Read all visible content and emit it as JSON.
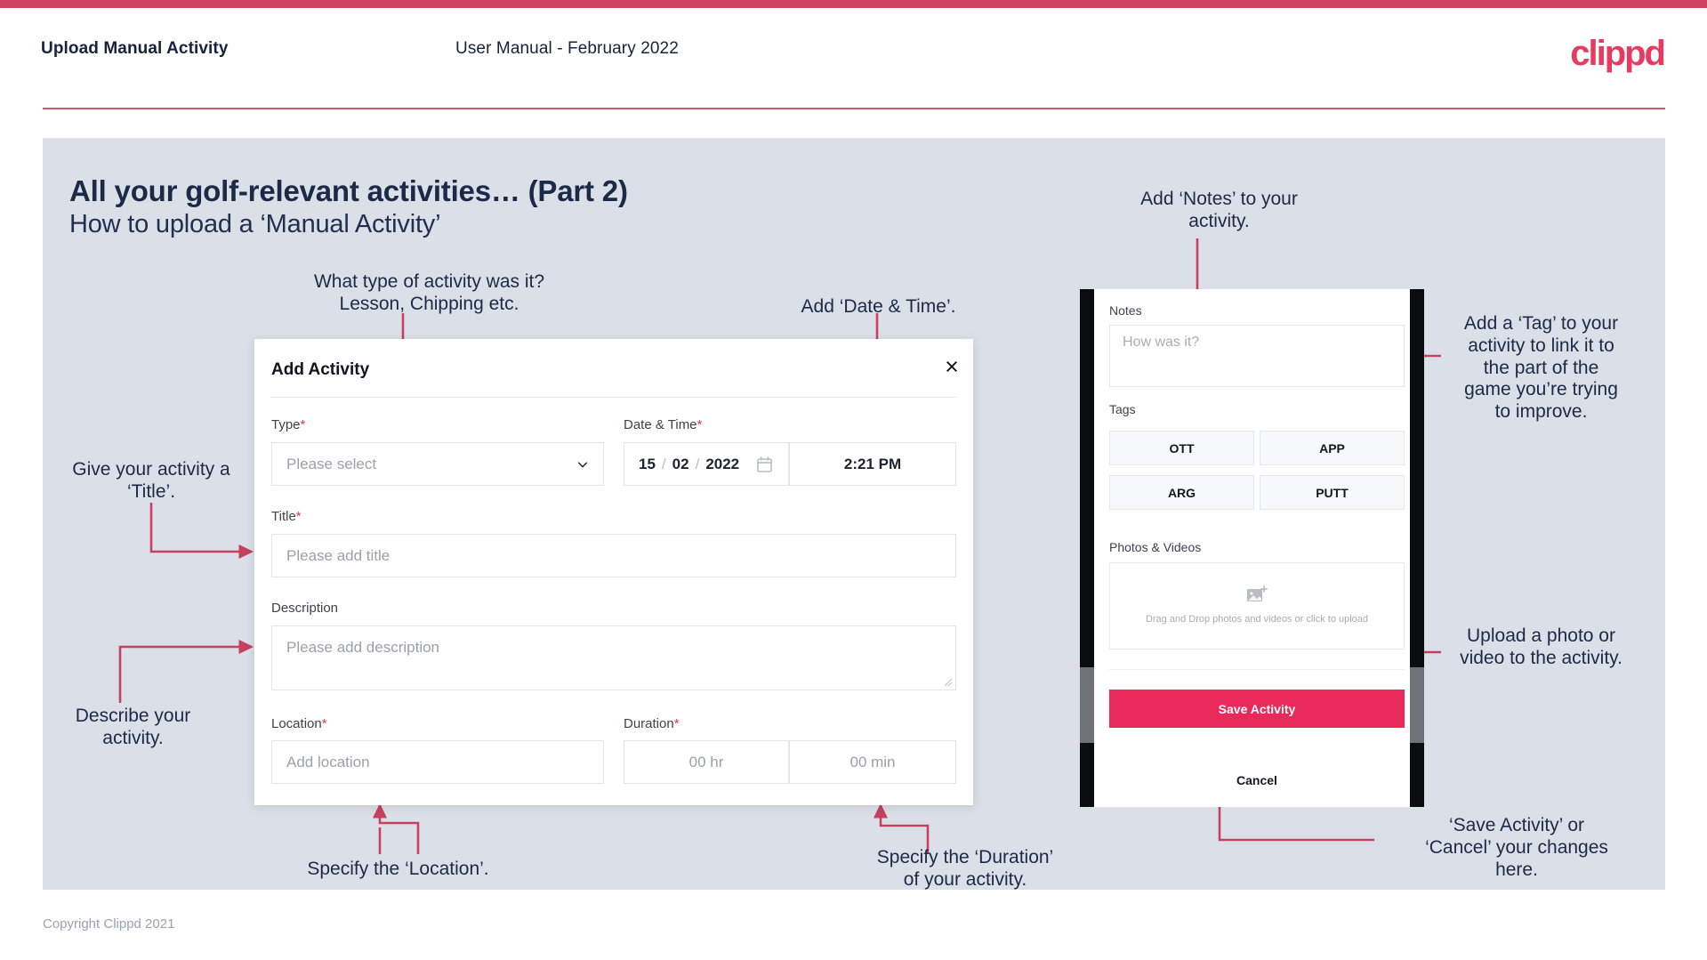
{
  "header": {
    "title": "Upload Manual Activity",
    "subtitle": "User Manual - February 2022",
    "logo": "clippd"
  },
  "slide": {
    "heading": "All your golf-relevant activities… (Part 2)",
    "subheading": "How to upload a ‘Manual Activity’",
    "copyright": "Copyright Clippd 2021"
  },
  "dialog": {
    "title": "Add Activity",
    "close_icon": "×",
    "fields": {
      "type": {
        "label": "Type",
        "required": "*",
        "placeholder": "Please select"
      },
      "datetime": {
        "label": "Date & Time",
        "required": "*",
        "day": "15",
        "month": "02",
        "year": "2022",
        "sep": "/",
        "time": "2:21 PM"
      },
      "title": {
        "label": "Title",
        "required": "*",
        "placeholder": "Please add title"
      },
      "description": {
        "label": "Description",
        "required": "",
        "placeholder": "Please add description"
      },
      "location": {
        "label": "Location",
        "required": "*",
        "placeholder": "Add location"
      },
      "duration": {
        "label": "Duration",
        "required": "*",
        "hours": "00 hr",
        "minutes": "00 min"
      }
    }
  },
  "phone": {
    "notes_label": "Notes",
    "notes_placeholder": "How was it?",
    "tags_label": "Tags",
    "tags": [
      "OTT",
      "APP",
      "ARG",
      "PUTT"
    ],
    "photos_label": "Photos & Videos",
    "drop_text": "Drag and Drop photos and videos or\nclick to upload",
    "save_label": "Save Activity",
    "cancel_label": "Cancel"
  },
  "annotations": {
    "type": "What type of activity was it?\nLesson, Chipping etc.",
    "datetime": "Add ‘Date & Time’.",
    "title": "Give your activity a\n‘Title’.",
    "description": "Describe your\nactivity.",
    "location": "Specify the ‘Location’.",
    "duration": "Specify the ‘Duration’\nof your activity.",
    "notes": "Add ‘Notes’ to your\nactivity.",
    "tags": "Add a ‘Tag’ to your\nactivity to link it to\nthe part of the\ngame you’re trying\nto improve.",
    "photos": "Upload a photo or\nvideo to the activity.",
    "save": "‘Save Activity’ or\n‘Cancel’ your changes\nhere."
  },
  "colors": {
    "brand": "#e8395f",
    "accent_bar": "#cf4360",
    "slide_bg": "#dbe0e8",
    "annotation_line": "#c7405e",
    "save_button": "#e8295a",
    "required": "#e03a4e"
  }
}
